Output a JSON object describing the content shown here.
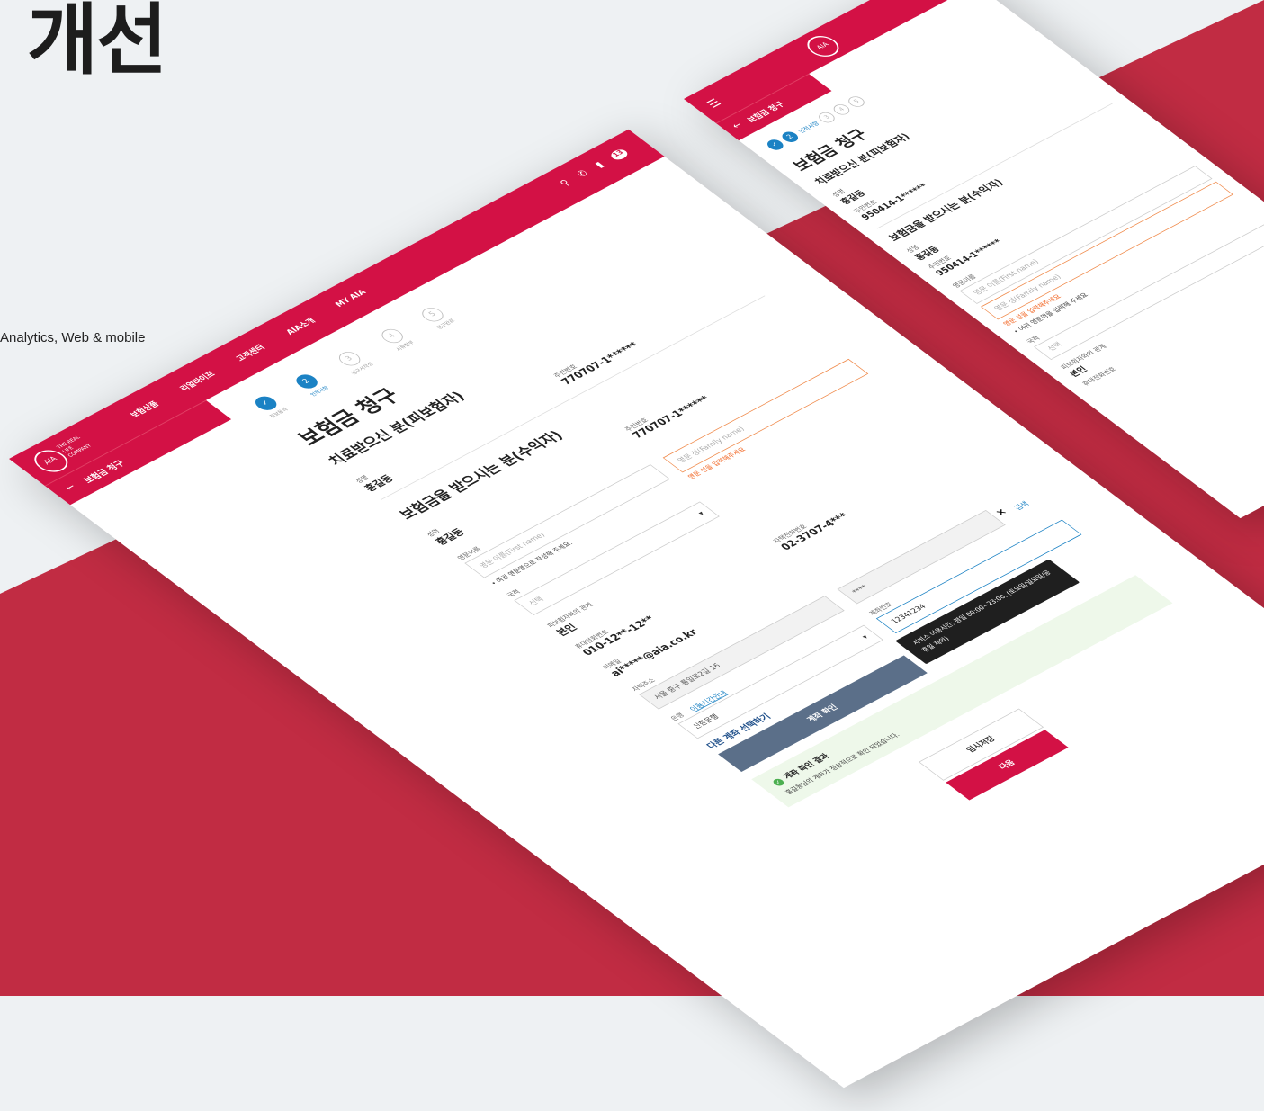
{
  "hero": {
    "title": "개선",
    "subtitle": "Analytics, Web & mobile"
  },
  "desktop": {
    "brand": {
      "logo": "AIA",
      "tagline": "THE REAL LIFE COMPANY"
    },
    "nav": [
      "보험상품",
      "리얼라이프",
      "고객센터",
      "AIA소개",
      "MY AIA"
    ],
    "badge_count": "13",
    "back_title": "보험금 청구",
    "steps": [
      {
        "num": "✓",
        "label": "정보동의"
      },
      {
        "num": "2",
        "label": "인적사항"
      },
      {
        "num": "3",
        "label": "청구서작성"
      },
      {
        "num": "4",
        "label": "서류첨부"
      },
      {
        "num": "5",
        "label": "청구완료"
      }
    ],
    "title": "보험금 청구",
    "patient": {
      "heading": "치료받으신 분(피보험자)",
      "name_label": "성명",
      "name": "홍길동",
      "rrn_label": "주민번호",
      "rrn": "770707-1******"
    },
    "beneficiary": {
      "heading": "보험금을 받으시는 분(수익자)",
      "name_label": "성명",
      "name": "홍길동",
      "rrn_label": "주민번호",
      "rrn": "770707-1******",
      "eng_name_label": "영문이름",
      "first_placeholder": "영문 이름(First name)",
      "family_placeholder": "영문 성(Family name)",
      "family_error": "영문 성을 입력해주세요",
      "eng_hint": "• 여권 영문명으로 작성해 주세요.",
      "nationality_label": "국적",
      "nationality_placeholder": "선택",
      "relation_label": "피보험자와의 관계",
      "relation": "본인",
      "mobile_label": "휴대전화번호",
      "mobile": "010-12**-12**",
      "home_phone_label": "자택전화번호",
      "home_phone": "02-3707-4***",
      "email_label": "이메일",
      "email": "ai*****@aia.co.kr",
      "address_label": "자택주소",
      "address": "서울 중구 통일로2길 16",
      "address_detail": "****",
      "search_label": "검색",
      "bank_label": "은행",
      "bank_hours_link": "이용시간안내",
      "bank": "신한은행",
      "account_label": "계좌번호",
      "account": "12341234",
      "other_account": "다른 계좌 선택하기",
      "verify_button": "계좌 확인",
      "tooltip": "서비스 이용시간: 평일 09:00~23:00, (토요일/일요일/공휴일 제외)",
      "result_title": "계좌 확인 결과",
      "result_text": "홍길동님의 계좌가 정상적으로 확인 되었습니다."
    },
    "save_button": "임시저장",
    "next_button": "다음"
  },
  "mobile": {
    "back_title": "보험금 청구",
    "badge_count": "13",
    "steps": [
      {
        "num": "✓"
      },
      {
        "num": "2",
        "label": "인적사항"
      },
      {
        "num": "3"
      },
      {
        "num": "4"
      },
      {
        "num": "5"
      }
    ],
    "title": "보험금 청구",
    "patient": {
      "heading": "치료받으신 분(피보험자)",
      "name_label": "성명",
      "name": "홍길동",
      "rrn_label": "주민번호",
      "rrn": "950414-1******"
    },
    "beneficiary": {
      "heading": "보험금을 받으시는 분(수익자)",
      "name_label": "성명",
      "name": "홍길동",
      "rrn_label": "주민번호",
      "rrn": "950414-1******",
      "eng_name_label": "영문이름",
      "first_placeholder": "영문 이름(First name)",
      "family_placeholder": "영문 성(Family name)",
      "family_error": "영문 성을 입력해주세요.",
      "eng_hint": "• 여권 영문명을 입력해 주세요.",
      "nationality_label": "국적",
      "nationality_placeholder": "선택",
      "relation_label": "피보험자와의 관계",
      "relation": "본인",
      "mobile_label": "휴대전화번호"
    }
  }
}
